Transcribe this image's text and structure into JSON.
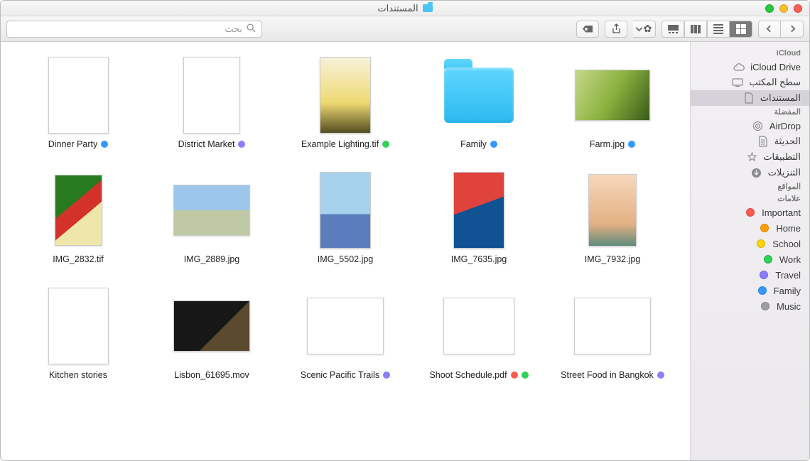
{
  "window_title": "المستندات",
  "search_placeholder": "بحث",
  "sidebar": {
    "sections": [
      {
        "header": "iCloud",
        "items": [
          {
            "id": "icloud-drive",
            "label": "iCloud Drive",
            "icon": "cloud"
          },
          {
            "id": "desktop",
            "label": "سطح المكتب",
            "icon": "desktop"
          },
          {
            "id": "documents",
            "label": "المستندات",
            "icon": "doc",
            "selected": true
          }
        ]
      },
      {
        "header": "المفضلة",
        "items": [
          {
            "id": "airdrop",
            "label": "AirDrop",
            "icon": "airdrop"
          },
          {
            "id": "recents",
            "label": "الحديثة",
            "icon": "recents"
          },
          {
            "id": "apps",
            "label": "التطبيقات",
            "icon": "apps"
          },
          {
            "id": "downloads",
            "label": "التنزيلات",
            "icon": "downloads"
          }
        ]
      },
      {
        "header": "المواقع",
        "items": []
      },
      {
        "header": "علامات",
        "items": [
          {
            "id": "tag-important",
            "label": "Important",
            "color": "#ff5a4d"
          },
          {
            "id": "tag-home",
            "label": "Home",
            "color": "#ff9f0a"
          },
          {
            "id": "tag-school",
            "label": "School",
            "color": "#ffd60a"
          },
          {
            "id": "tag-work",
            "label": "Work",
            "color": "#30d158"
          },
          {
            "id": "tag-travel",
            "label": "Travel",
            "color": "#8a7dff"
          },
          {
            "id": "tag-family",
            "label": "Family",
            "color": "#3498ff"
          },
          {
            "id": "tag-music",
            "label": "Music",
            "color": "#9e9e9e"
          }
        ]
      }
    ]
  },
  "items": [
    {
      "name": "Dinner Party",
      "tags": [
        "#3498ff"
      ],
      "kind": "doc",
      "w": 85,
      "h": 108,
      "cls": "t4"
    },
    {
      "name": "District Market",
      "tags": [
        "#8a7dff"
      ],
      "kind": "doc",
      "w": 80,
      "h": 108,
      "cls": "t3"
    },
    {
      "name": "Example Lighting.tif",
      "tags": [
        "#30d158"
      ],
      "kind": "img",
      "w": 72,
      "h": 108,
      "cls": "t2"
    },
    {
      "name": "Family",
      "tags": [
        "#3498ff"
      ],
      "kind": "folder"
    },
    {
      "name": "Farm.jpg",
      "tags": [
        "#3498ff"
      ],
      "kind": "img",
      "w": 106,
      "h": 72,
      "cls": "t0"
    },
    {
      "name": "IMG_2832.tif",
      "tags": [],
      "kind": "img",
      "w": 67,
      "h": 100,
      "cls": "t9"
    },
    {
      "name": "IMG_2889.jpg",
      "tags": [],
      "kind": "img",
      "w": 108,
      "h": 72,
      "cls": "t8"
    },
    {
      "name": "IMG_5502.jpg",
      "tags": [],
      "kind": "img",
      "w": 72,
      "h": 108,
      "cls": "t7"
    },
    {
      "name": "IMG_7635.jpg",
      "tags": [],
      "kind": "img",
      "w": 72,
      "h": 108,
      "cls": "t6"
    },
    {
      "name": "IMG_7932.jpg",
      "tags": [],
      "kind": "img",
      "w": 68,
      "h": 102,
      "cls": "t5"
    },
    {
      "name": "Kitchen stories",
      "tags": [],
      "kind": "doc",
      "w": 85,
      "h": 108,
      "cls": "t14"
    },
    {
      "name": "Lisbon_61695.mov",
      "tags": [],
      "kind": "img",
      "w": 108,
      "h": 72,
      "cls": "t13"
    },
    {
      "name": "Scenic Pacific Trails",
      "tags": [
        "#8a7dff"
      ],
      "kind": "doc",
      "w": 108,
      "h": 80,
      "cls": "t12"
    },
    {
      "name": "Shoot Schedule.pdf",
      "tags": [
        "#ff5a4d",
        "#30d158"
      ],
      "kind": "doc",
      "w": 100,
      "h": 80,
      "cls": "t11"
    },
    {
      "name": "Street Food in Bangkok",
      "tags": [
        "#8a7dff"
      ],
      "kind": "doc",
      "w": 108,
      "h": 80,
      "cls": "t10"
    }
  ]
}
